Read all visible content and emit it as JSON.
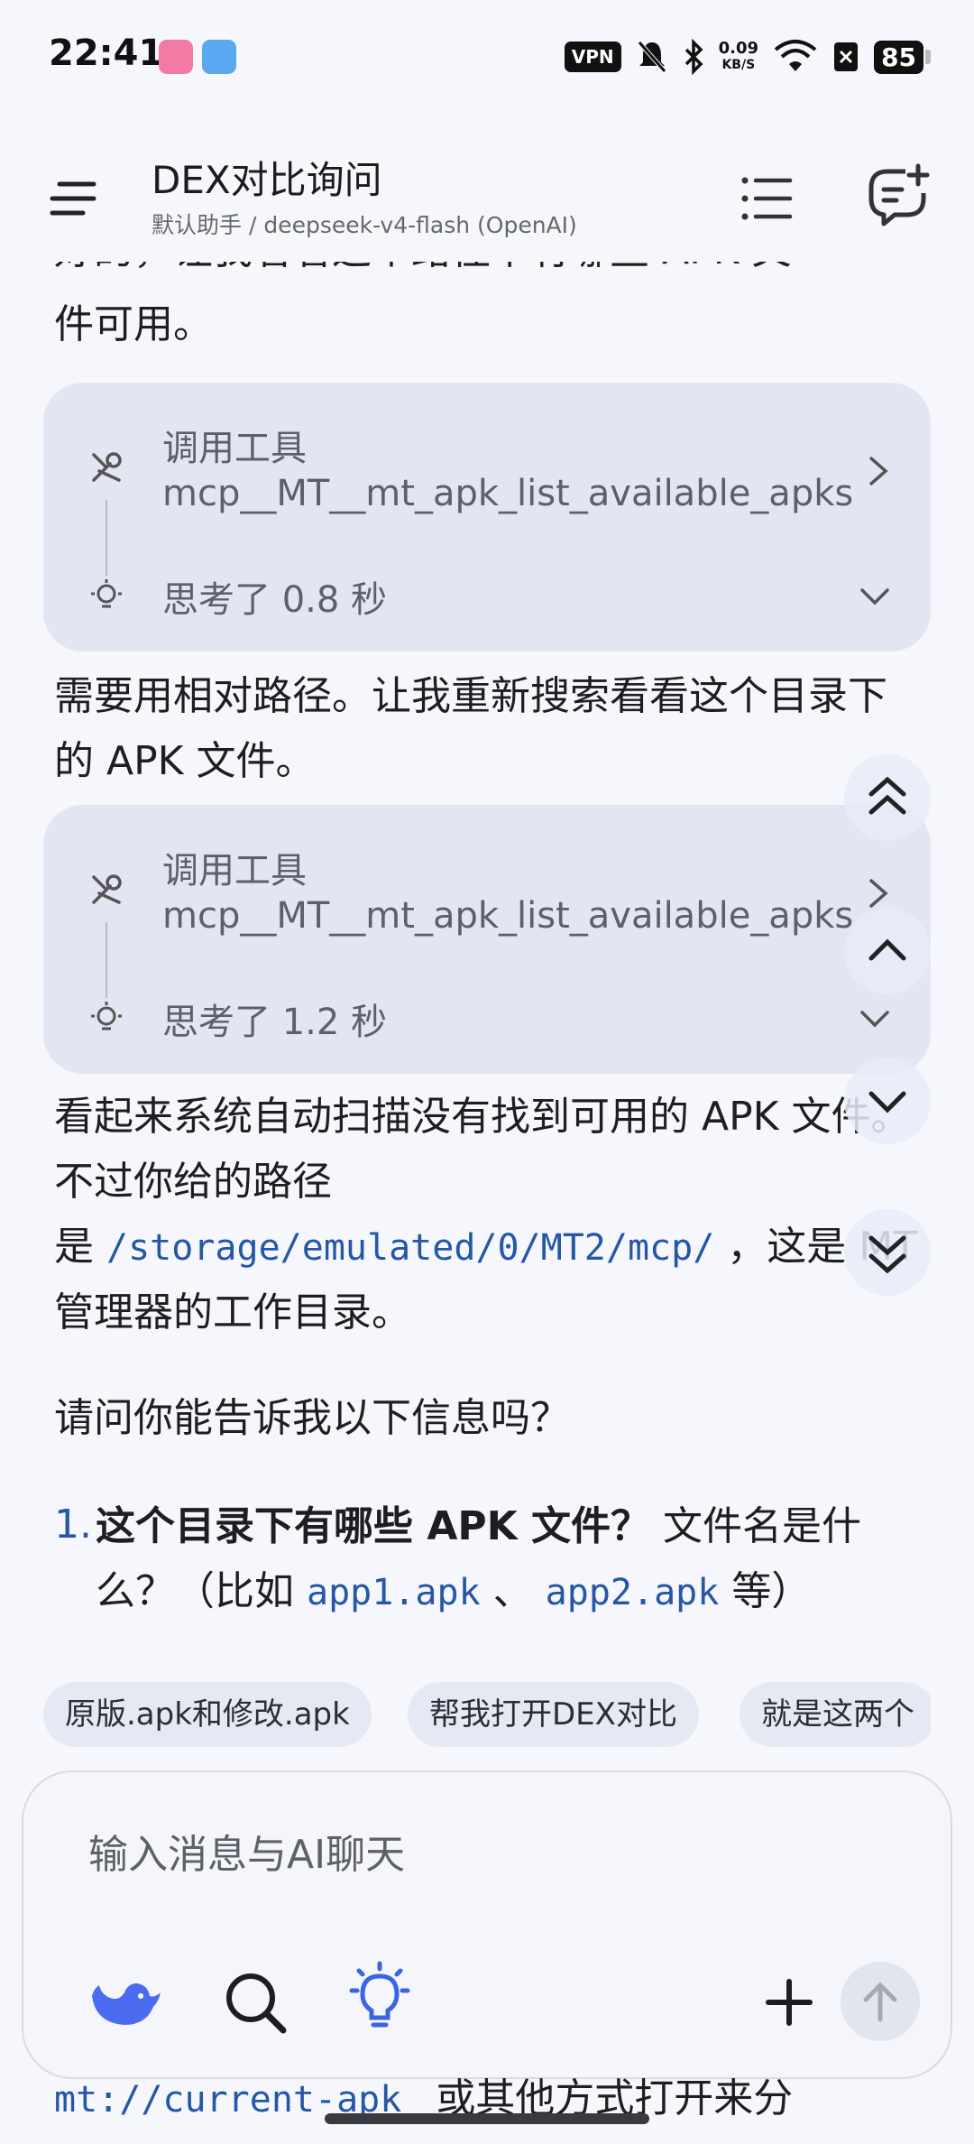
{
  "status_bar": {
    "time": "22:41",
    "vpn": "VPN",
    "speed_value": "0.09",
    "speed_unit": "KB/S",
    "battery": "85"
  },
  "header": {
    "title": "DEX对比询问",
    "subtitle": "默认助手 / deepseek-v4-flash (OpenAI)"
  },
  "messages": {
    "cut_text": "好的，让我看看这个路径下有哪些 APK 文",
    "para1": "件可用。",
    "tool_cards": [
      {
        "label": "调用工具",
        "name": "mcp__MT__mt_apk_list_available_apks",
        "think": "思考了 0.8 秒"
      },
      {
        "label": "调用工具",
        "name": "mcp__MT__mt_apk_list_available_apks",
        "think": "思考了 1.2 秒"
      }
    ],
    "para2": "需要用相对路径。让我重新搜索看看这个目录下的 APK 文件。",
    "para3_a": "看起来系统自动扫描没有找到可用的 APK 文件。不过你给的路径是",
    "para3_code": "/storage/emulated/0/MT2/mcp/",
    "para3_b": "，这是 MT 管理器的工作目录。",
    "para4": "请问你能告诉我以下信息吗？",
    "list_item_1": {
      "number": "1.",
      "bold": "这个目录下有哪些 APK 文件？",
      "text_a": "文件名是什么？（比如",
      "code1": "app1.apk",
      "sep": "、",
      "code2": "app2.apk",
      "text_b": "等）"
    },
    "bottom_code": "mt://current-apk",
    "bottom_text": "或其他方式打开来分"
  },
  "suggestions": [
    "原版.apk和修改.apk",
    "帮我打开DEX对比",
    "就是这两个"
  ],
  "composer": {
    "placeholder": "输入消息与AI聊天"
  },
  "icons": {
    "menu": "menu-icon",
    "list": "list-icon",
    "new_chat": "new-chat-icon",
    "tool": "tool-icon",
    "bulb": "bulb-icon",
    "model": "deepseek-whale-icon",
    "search": "search-icon",
    "think": "think-bulb-icon",
    "plus": "plus-icon",
    "send": "arrow-up-icon"
  },
  "colors": {
    "accent_blue": "#2557a6",
    "card_bg": "#e3e5f2",
    "page_bg": "#f6f7fc"
  }
}
